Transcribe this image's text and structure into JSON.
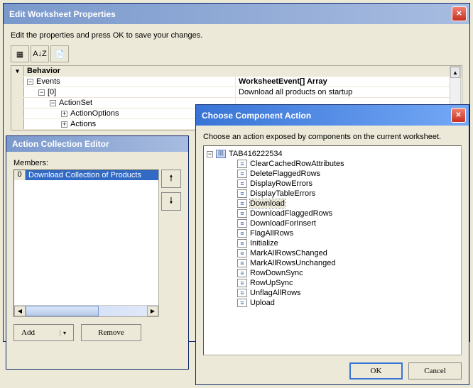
{
  "window1": {
    "title": "Edit Worksheet Properties",
    "instruction": "Edit the properties and press OK to save your changes.",
    "sort_label": "A↓Z",
    "grid": {
      "behavior_label": "Behavior",
      "rows": [
        {
          "key": "Events",
          "val": "WorksheetEvent[] Array",
          "indent": 0,
          "exp": "-"
        },
        {
          "key": "[0]",
          "val": "Download all products on startup",
          "indent": 1,
          "exp": "-"
        },
        {
          "key": "ActionSet",
          "val": "",
          "indent": 2,
          "exp": "-"
        },
        {
          "key": "ActionOptions",
          "val": "",
          "indent": 3,
          "exp": "+"
        },
        {
          "key": "Actions",
          "val": "",
          "indent": 3,
          "exp": "+"
        }
      ]
    }
  },
  "window2": {
    "title": "Action Collection Editor",
    "members_label": "Members:",
    "items": [
      {
        "index": "0",
        "label": "Download Collection of Products"
      }
    ],
    "add_label": "Add",
    "remove_label": "Remove"
  },
  "window3": {
    "title": "Choose Component Action",
    "instruction": "Choose an action exposed by components on the current worksheet.",
    "root": "TAB416222534",
    "actions": [
      "ClearCachedRowAttributes",
      "DeleteFlaggedRows",
      "DisplayRowErrors",
      "DisplayTableErrors",
      "Download",
      "DownloadFlaggedRows",
      "DownloadForInsert",
      "FlagAllRows",
      "Initialize",
      "MarkAllRowsChanged",
      "MarkAllRowsUnchanged",
      "RowDownSync",
      "RowUpSync",
      "UnflagAllRows",
      "Upload"
    ],
    "selected": "Download",
    "ok": "OK",
    "cancel": "Cancel"
  }
}
